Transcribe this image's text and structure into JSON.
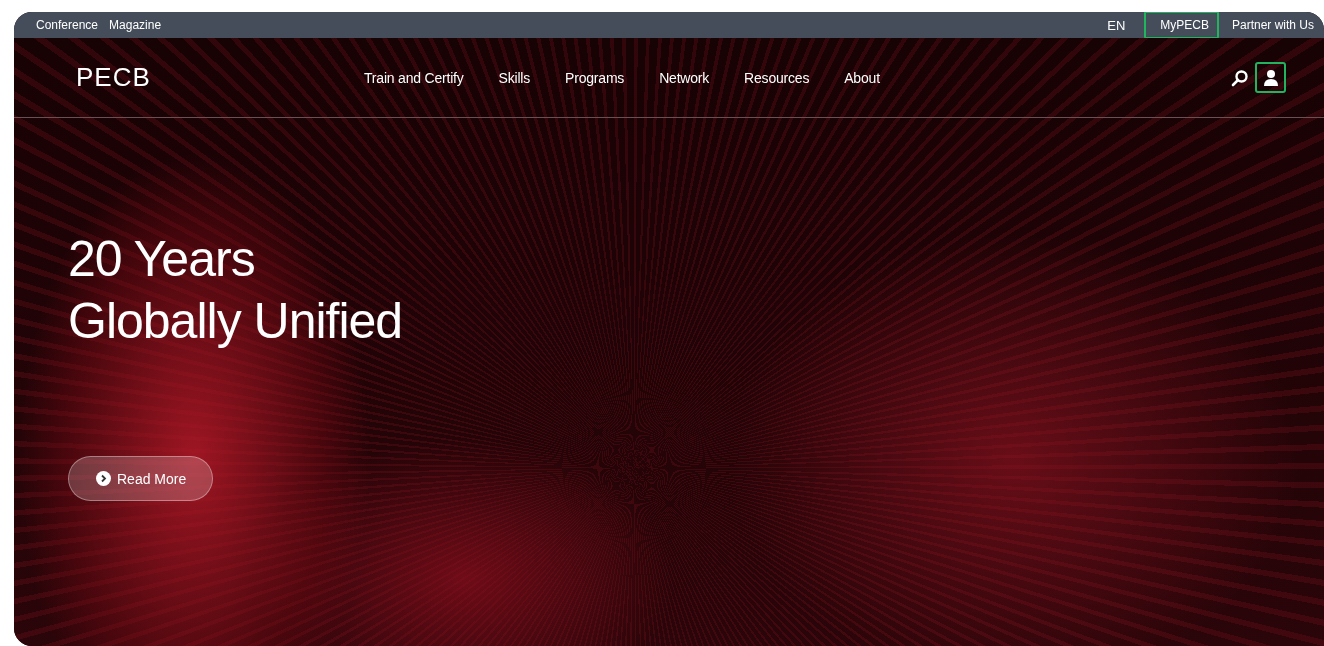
{
  "top_bar": {
    "left_links": [
      "Conference",
      "Magazine"
    ],
    "language": "EN",
    "right_links": [
      {
        "label": "MyPECB",
        "highlighted": true
      },
      {
        "label": "Partner with Us",
        "highlighted": false
      }
    ]
  },
  "nav": {
    "logo": "PECB",
    "items": [
      "Train and Certify",
      "Skills",
      "Programs",
      "Network",
      "Resources",
      "About"
    ],
    "user_button": {
      "highlighted": true
    }
  },
  "hero": {
    "title_lines": [
      "20 Years",
      "Globally Unified"
    ],
    "button": "Read More"
  }
}
